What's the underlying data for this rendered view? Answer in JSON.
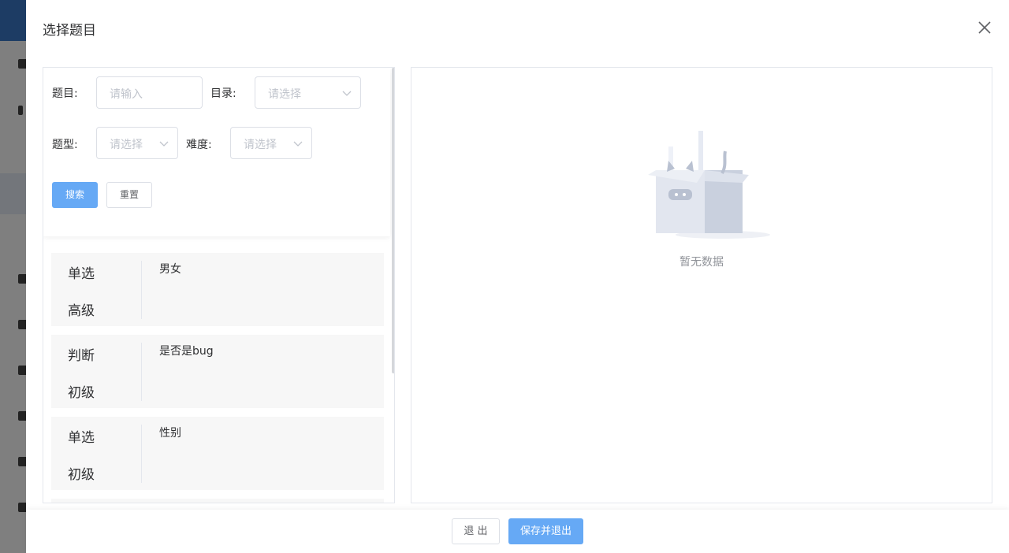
{
  "dialog": {
    "title": "选择题目"
  },
  "filters": {
    "title_label": "题目:",
    "title_placeholder": "请输入",
    "catalog_label": "目录:",
    "catalog_placeholder": "请选择",
    "type_label": "题型:",
    "type_placeholder": "请选择",
    "difficulty_label": "难度:",
    "difficulty_placeholder": "请选择",
    "search_label": "搜索",
    "reset_label": "重置"
  },
  "questions": [
    {
      "type": "单选",
      "level": "高级",
      "title": "男女"
    },
    {
      "type": "判断",
      "level": "初级",
      "title": "是否是bug"
    },
    {
      "type": "单选",
      "level": "初级",
      "title": "性别"
    }
  ],
  "selected": {
    "empty_text": "暂无数据"
  },
  "footer": {
    "exit_label": "退 出",
    "save_label": "保存并退出"
  },
  "colors": {
    "primary": "#66a9f5",
    "sidebar_header": "#3a78c9"
  },
  "icons": [
    "close-icon",
    "chevron-down-icon",
    "empty-box-illustration"
  ]
}
